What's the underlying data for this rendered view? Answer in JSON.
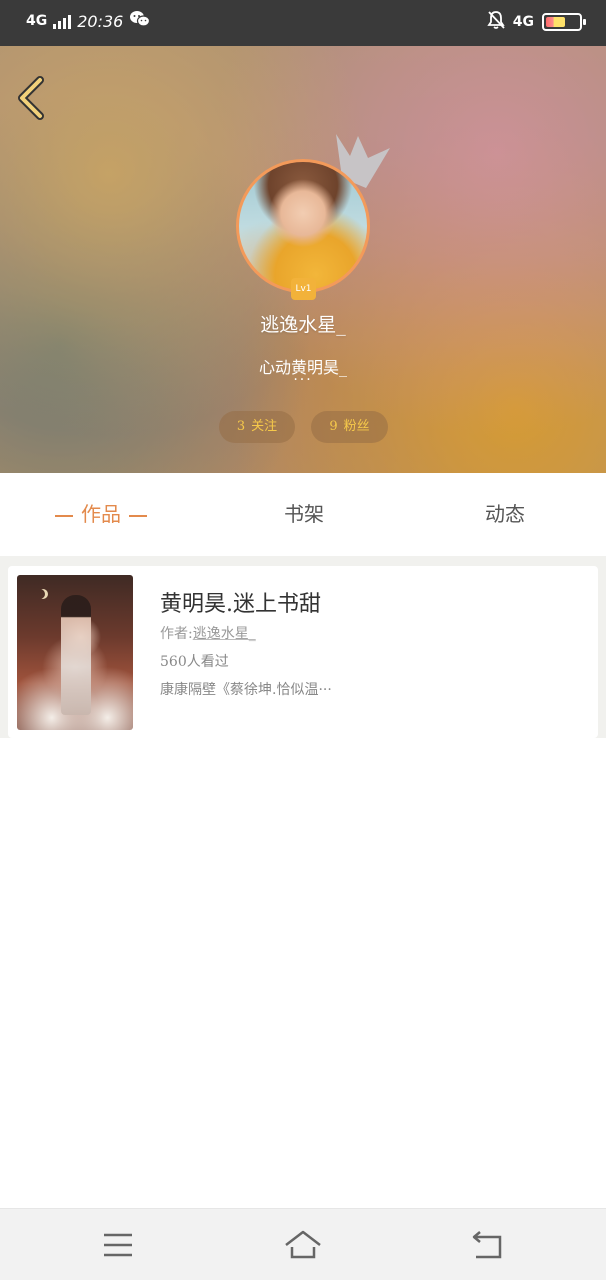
{
  "status_bar": {
    "network_left": "4G",
    "time": "20:36",
    "network_right": "4G",
    "icons": [
      "signal-icon",
      "wechat-icon",
      "mute-bell-icon",
      "battery-icon"
    ]
  },
  "profile": {
    "level_badge": "Lv1",
    "username": "逃逸水星_",
    "signature": "心动黄明昊_",
    "signature_more": "···",
    "following_count": "3",
    "following_label": "关注",
    "fans_count": "9",
    "fans_label": "粉丝"
  },
  "tabs": {
    "items": [
      {
        "label": "作品",
        "active": true
      },
      {
        "label": "书架",
        "active": false
      },
      {
        "label": "动态",
        "active": false
      }
    ],
    "accent_color": "#e38a4c"
  },
  "works": [
    {
      "title": "黄明昊.迷上书甜",
      "author_prefix": "作者:",
      "author": "逃逸水星_",
      "views": "560人看过",
      "description": "康康隔壁《蔡徐坤.恰似温···"
    }
  ],
  "nav_bar": {
    "icons": [
      "menu-icon",
      "home-icon",
      "back-icon"
    ]
  }
}
